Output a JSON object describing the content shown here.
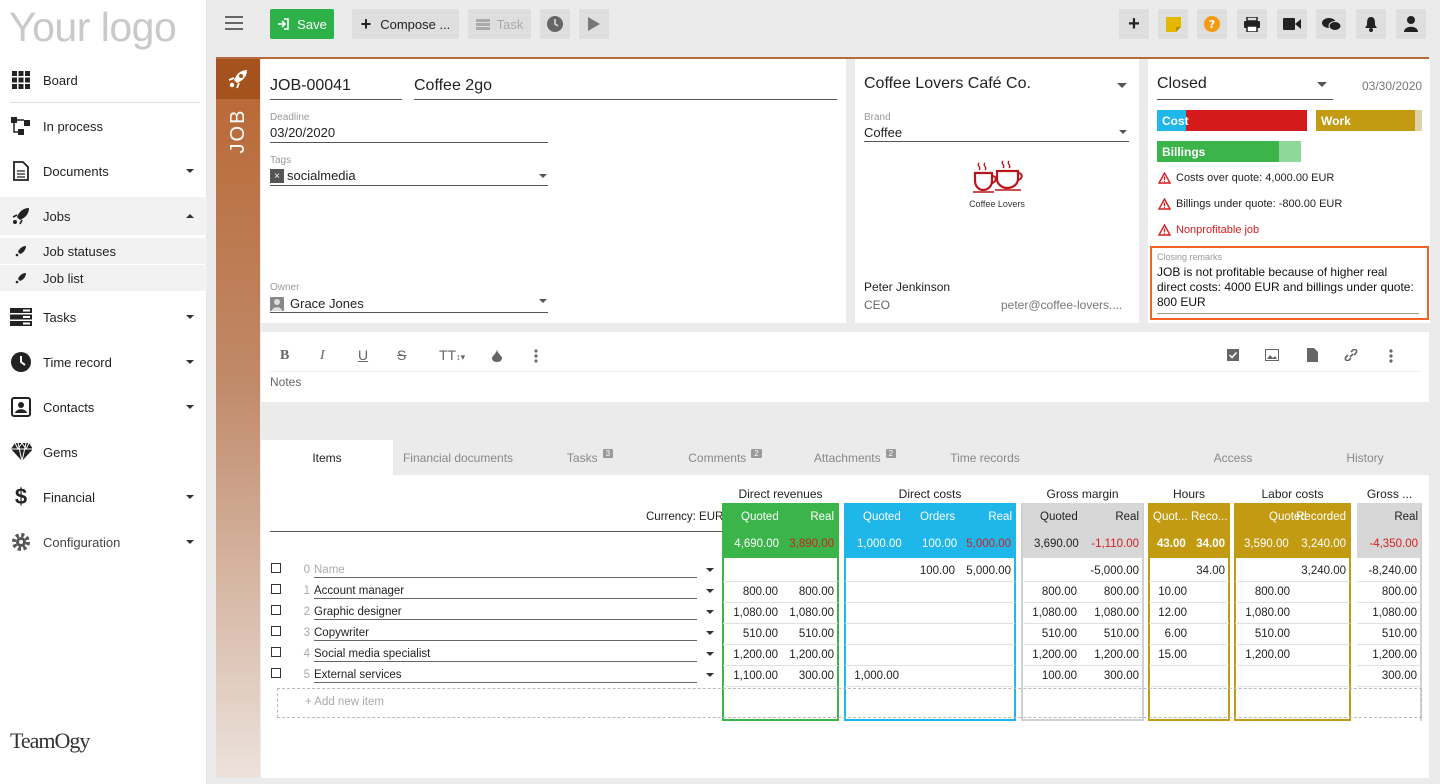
{
  "app": {
    "logo_text": "Your logo",
    "brand_footer": "TeamOgy"
  },
  "sidebar": {
    "items": [
      {
        "label": "Board"
      },
      {
        "label": "In process"
      },
      {
        "label": "Documents"
      },
      {
        "label": "Jobs"
      },
      {
        "label": "Job statuses"
      },
      {
        "label": "Job list"
      },
      {
        "label": "Tasks"
      },
      {
        "label": "Time record"
      },
      {
        "label": "Contacts"
      },
      {
        "label": "Gems"
      },
      {
        "label": "Financial"
      },
      {
        "label": "Configuration"
      }
    ]
  },
  "toolbar": {
    "save_label": "Save",
    "compose_label": "Compose ...",
    "task_label": "Task"
  },
  "job": {
    "vertical_label": "JOB",
    "number": "JOB-00041",
    "name": "Coffee 2go",
    "deadline_label": "Deadline",
    "deadline": "03/20/2020",
    "tags_label": "Tags",
    "tag": "socialmedia",
    "owner_label": "Owner",
    "owner": "Grace Jones"
  },
  "client": {
    "company": "Coffee Lovers Café Co.",
    "brand_label": "Brand",
    "brand": "Coffee",
    "logo_caption": "Coffee Lovers",
    "contact_name": "Peter Jenkinson",
    "contact_role": "CEO",
    "contact_email": "peter@coffee-lovers...."
  },
  "status": {
    "value": "Closed",
    "date": "03/30/2020",
    "bars": {
      "cost": "Cost",
      "work": "Work",
      "billings": "Billings"
    },
    "bar_levels": {
      "cost_blue_fraction": 0.19,
      "work_fill_fraction": 0.93,
      "billings_fill_fraction": 0.85
    },
    "alerts": [
      "Costs over quote: 4,000.00 EUR",
      "Billings under quote: -800.00 EUR",
      "Nonprofitable job"
    ],
    "closing_label": "Closing remarks",
    "closing_text": "JOB is not profitable because of higher real direct costs: 4000 EUR and billings under quote: 800 EUR"
  },
  "editor": {
    "notes_placeholder": "Notes",
    "tt_label": "TT"
  },
  "tabs": [
    {
      "label": "Items"
    },
    {
      "label": "Financial documents"
    },
    {
      "label": "Tasks",
      "badge": "3"
    },
    {
      "label": "Comments",
      "badge": "2"
    },
    {
      "label": "Attachments",
      "badge": "2"
    },
    {
      "label": "Time records"
    },
    {
      "label": "Access"
    },
    {
      "label": "History"
    }
  ],
  "table": {
    "currency_label": "Currency: EUR",
    "groups": {
      "direct_revenues": "Direct revenues",
      "direct_costs": "Direct costs",
      "gross_margin": "Gross margin",
      "hours": "Hours",
      "labor_costs": "Labor costs",
      "gross_more": "Gross ..."
    },
    "subheaders": {
      "quoted": "Quoted",
      "real": "Real",
      "orders": "Orders",
      "hours_quoted": "Quot...",
      "hours_recorded": "Reco...",
      "recorded": "Recorded"
    },
    "totals": {
      "dr_quoted": "4,690.00",
      "dr_real": "3,890.00",
      "dc_quoted": "1,000.00",
      "dc_orders": "100.00",
      "dc_real": "5,000.00",
      "gm_quoted": "3,690.00",
      "gm_real": "-1,110.00",
      "h_quoted": "43.00",
      "h_recorded": "34.00",
      "lc_quoted": "3,590.00",
      "lc_recorded": "3,240.00",
      "g_real": "-4,350.00"
    },
    "rows": [
      {
        "num": "0",
        "name": "Name",
        "dr_q": "",
        "dr_r": "",
        "dc_q": "",
        "dc_o": "100.00",
        "dc_r": "5,000.00",
        "gm_q": "",
        "gm_r": "-5,000.00",
        "h_q": "",
        "h_r": "34.00",
        "lc_q": "",
        "lc_r": "3,240.00",
        "g_r": "-8,240.00"
      },
      {
        "num": "1",
        "name": "Account manager",
        "dr_q": "800.00",
        "dr_r": "800.00",
        "dc_q": "",
        "dc_o": "",
        "dc_r": "",
        "gm_q": "800.00",
        "gm_r": "800.00",
        "h_q": "10.00",
        "h_r": "",
        "lc_q": "800.00",
        "lc_r": "",
        "g_r": "800.00"
      },
      {
        "num": "2",
        "name": "Graphic designer",
        "dr_q": "1,080.00",
        "dr_r": "1,080.00",
        "dc_q": "",
        "dc_o": "",
        "dc_r": "",
        "gm_q": "1,080.00",
        "gm_r": "1,080.00",
        "h_q": "12.00",
        "h_r": "",
        "lc_q": "1,080.00",
        "lc_r": "",
        "g_r": "1,080.00"
      },
      {
        "num": "3",
        "name": "Copywriter",
        "dr_q": "510.00",
        "dr_r": "510.00",
        "dc_q": "",
        "dc_o": "",
        "dc_r": "",
        "gm_q": "510.00",
        "gm_r": "510.00",
        "h_q": "6.00",
        "h_r": "",
        "lc_q": "510.00",
        "lc_r": "",
        "g_r": "510.00"
      },
      {
        "num": "4",
        "name": "Social media specialist",
        "dr_q": "1,200.00",
        "dr_r": "1,200.00",
        "dc_q": "",
        "dc_o": "",
        "dc_r": "",
        "gm_q": "1,200.00",
        "gm_r": "1,200.00",
        "h_q": "15.00",
        "h_r": "",
        "lc_q": "1,200.00",
        "lc_r": "",
        "g_r": "1,200.00"
      },
      {
        "num": "5",
        "name": "External services",
        "dr_q": "1,100.00",
        "dr_r": "300.00",
        "dc_q": "1,000.00",
        "dc_o": "",
        "dc_r": "",
        "gm_q": "100.00",
        "gm_r": "300.00",
        "h_q": "",
        "h_r": "",
        "lc_q": "",
        "lc_r": "",
        "g_r": "300.00"
      }
    ],
    "add_item_label": "+ Add new item"
  },
  "colors": {
    "green": "#3bb44a",
    "blue": "#1fb6ea",
    "gold": "#c29b12",
    "gray": "#d7d7d7",
    "red": "#d11f1f",
    "job_brown": "#b46a3a",
    "closing_border": "#f06524"
  }
}
